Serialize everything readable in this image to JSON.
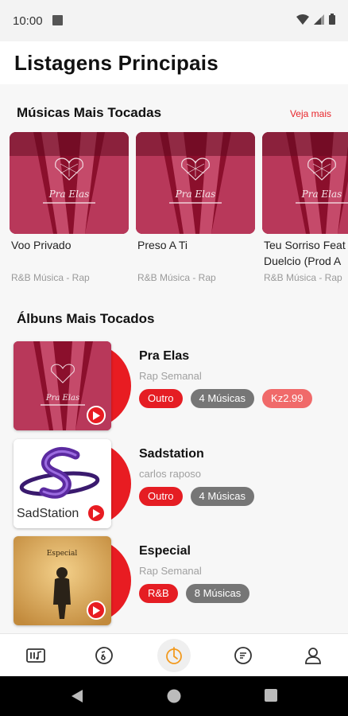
{
  "status_bar": {
    "time": "10:00"
  },
  "header": {
    "title": "Listagens Principais"
  },
  "songs_section": {
    "title": "Músicas Mais Tocadas",
    "see_more": "Veja mais",
    "items": [
      {
        "title": "Voo Privado",
        "subtitle": "R&B Música - Rap",
        "cover_text": "Pra Elas"
      },
      {
        "title": "Preso A Ti",
        "subtitle": "R&B Música - Rap",
        "cover_text": "Pra Elas"
      },
      {
        "title": "Teu Sorriso Feat Duelcio (Prod A",
        "subtitle": "R&B Música - Rap",
        "cover_text": "Pra Elas"
      }
    ]
  },
  "albums_section": {
    "title": "Álbuns Mais Tocados",
    "items": [
      {
        "title": "Pra Elas",
        "artist": "Rap Semanal",
        "genre": "Outro",
        "tracks": "4 Músicas",
        "price": "Kz2.99",
        "cover_text": "Pra Elas"
      },
      {
        "title": "Sadstation",
        "artist": "carlos raposo",
        "genre": "Outro",
        "tracks": "4 Músicas",
        "cover_text": "SadStation"
      },
      {
        "title": "Especial",
        "artist": "Rap Semanal",
        "genre": "R&B",
        "tracks": "8 Músicas",
        "cover_text": "Especial"
      }
    ]
  },
  "bottom_nav": {
    "items": [
      {
        "icon": "music-library-icon"
      },
      {
        "icon": "vinyl-record-icon"
      },
      {
        "icon": "trending-icon",
        "active": true
      },
      {
        "icon": "playlist-icon"
      },
      {
        "icon": "profile-icon"
      }
    ]
  },
  "colors": {
    "accent": "#e81c22",
    "chip_gray": "#767676",
    "price_chip": "#f06a6a",
    "active_nav": "#f29a1f"
  }
}
